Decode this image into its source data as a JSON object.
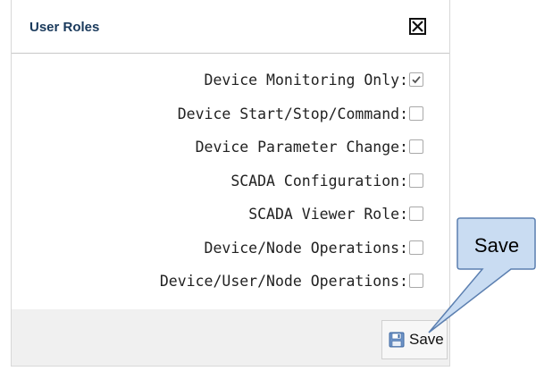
{
  "dialog": {
    "title": "User Roles",
    "close_icon": "close-icon"
  },
  "roles": [
    {
      "label": "Device Monitoring Only:",
      "checked": true
    },
    {
      "label": "Device Start/Stop/Command:",
      "checked": false
    },
    {
      "label": "Device Parameter Change:",
      "checked": false
    },
    {
      "label": "SCADA Configuration:",
      "checked": false
    },
    {
      "label": "SCADA Viewer Role:",
      "checked": false
    },
    {
      "label": "Device/Node Operations:",
      "checked": false
    },
    {
      "label": "Device/User/Node Operations:",
      "checked": false
    }
  ],
  "footer": {
    "save_label": "Save",
    "save_icon": "floppy-disk-icon"
  },
  "callout": {
    "text": "Save",
    "fill_color": "#c9dcf2",
    "border_color": "#5b7fb0"
  }
}
